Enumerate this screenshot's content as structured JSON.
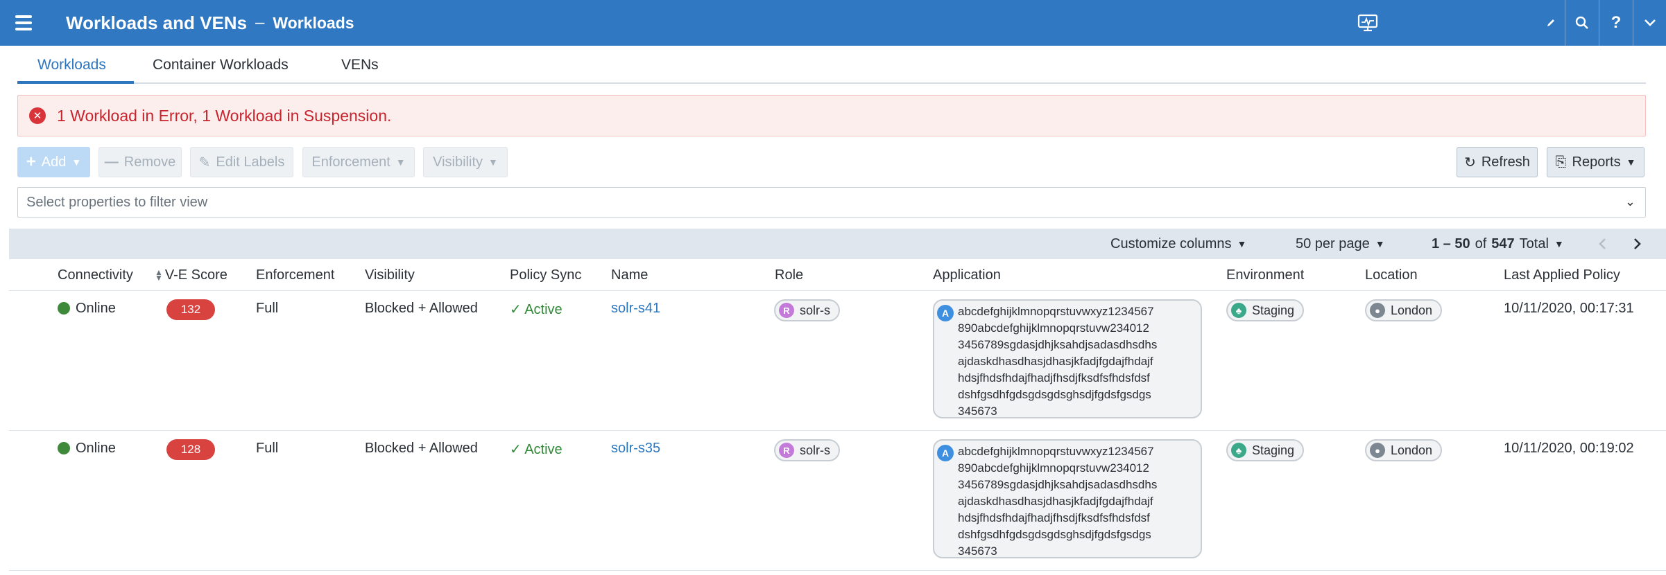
{
  "header": {
    "title": "Workloads and VENs",
    "separator": "–",
    "subtitle": "Workloads",
    "icons": [
      "menu-icon",
      "monitor-icon",
      "pencil-icon",
      "search-icon",
      "help-icon",
      "chevron-down-icon"
    ],
    "help_label": "?"
  },
  "tabs": [
    {
      "label": "Workloads",
      "active": true
    },
    {
      "label": "Container Workloads",
      "active": false
    },
    {
      "label": "VENs",
      "active": false
    }
  ],
  "banner": {
    "icon": "error-icon",
    "icon_glyph": "✕",
    "message": "1 Workload in Error, 1 Workload in Suspension."
  },
  "toolbar": {
    "add_label": "Add",
    "remove_label": "Remove",
    "edit_labels_label": "Edit Labels",
    "enforcement_label": "Enforcement",
    "visibility_label": "Visibility",
    "refresh_label": "Refresh",
    "reports_label": "Reports"
  },
  "filter": {
    "placeholder": "Select properties to filter view"
  },
  "pagination": {
    "customize_label": "Customize columns",
    "per_page_label": "50 per page",
    "range": "1 – 50",
    "of_label": "of",
    "total": "547",
    "total_label": "Total"
  },
  "columns": [
    "Connectivity",
    "V-E Score",
    "Enforcement",
    "Visibility",
    "Policy Sync",
    "Name",
    "Role",
    "Application",
    "Environment",
    "Location",
    "Last Applied Policy"
  ],
  "rows": [
    {
      "connectivity": "Online",
      "ve_score": "132",
      "enforcement": "Full",
      "visibility": "Blocked + Allowed",
      "policy_sync": "Active",
      "name": "solr-s41",
      "role": "solr-s",
      "application_lines": [
        "abcdefghijklmnopqrstuvwxyz1234567",
        "890abcdefghijklmnopqrstuvw234012",
        "3456789sgdasjdhjksahdjsadasdhsdhs",
        "ajdaskdhasdhasjdhasjkfadjfgdajfhdajf",
        "hdsjfhdsfhdajfhadjfhsdjfksdfsfhdsfdsf",
        "dshfgsdhfgdsgdsgdsghsdjfgdsfgsdgs",
        "345673"
      ],
      "environment": "Staging",
      "location": "London",
      "last_applied": "10/11/2020, 00:17:31"
    },
    {
      "connectivity": "Online",
      "ve_score": "128",
      "enforcement": "Full",
      "visibility": "Blocked + Allowed",
      "policy_sync": "Active",
      "name": "solr-s35",
      "role": "solr-s",
      "application_lines": [
        "abcdefghijklmnopqrstuvwxyz1234567",
        "890abcdefghijklmnopqrstuvw234012",
        "3456789sgdasjdhjksahdjsadasdhsdhs",
        "ajdaskdhasdhasjdhasjkfadjfgdajfhdajf",
        "hdsjfhdsfhdajfhadjfhsdjfksdfsfhdsfdsf",
        "dshfgsdhfgdsgdsgdsghsdjfgdsfgsdgs",
        "345673"
      ],
      "environment": "Staging",
      "location": "London",
      "last_applied": "10/11/2020, 00:19:02"
    }
  ],
  "colors": {
    "header": "#3078c2",
    "accent": "#2c76c0",
    "error": "#d8343a",
    "online": "#3e8a3a",
    "score": "#d8433f"
  }
}
